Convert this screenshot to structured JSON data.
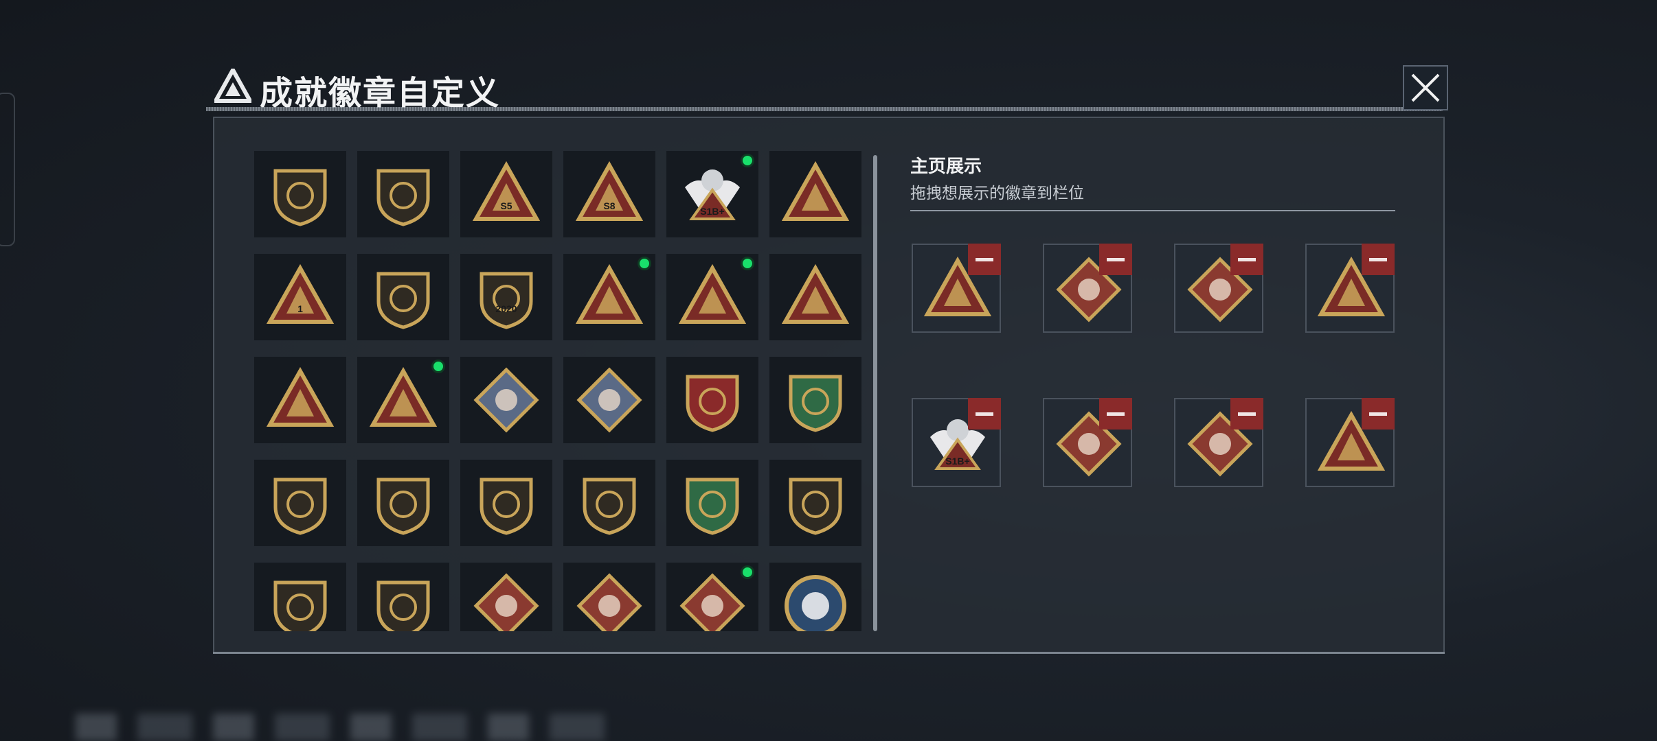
{
  "header": {
    "title": "成就徽章自定义"
  },
  "right_panel": {
    "title": "主页展示",
    "subtitle": "拖拽想展示的徽章到栏位"
  },
  "colors": {
    "accent_green": "#19e06b",
    "remove_red": "#8a2a2a",
    "gold": "#c9a55a",
    "maroon": "#7a2b26"
  },
  "badge_grid": [
    [
      {
        "icon": "tri-logo-shield-icon",
        "new": false
      },
      {
        "icon": "helicopter-shield-icon",
        "new": false
      },
      {
        "icon": "s5-bag-triangle-icon",
        "new": false,
        "label": "S5"
      },
      {
        "icon": "s8-bag-triangle-icon",
        "new": false,
        "label": "S8"
      },
      {
        "icon": "winged-skull-s1b-icon",
        "new": true,
        "label": "S1B+"
      },
      {
        "icon": "gold-egg-triangle-icon",
        "new": false
      }
    ],
    [
      {
        "icon": "number-one-triangle-icon",
        "new": false,
        "label": "1"
      },
      {
        "icon": "delta-force-tank-icon",
        "new": false
      },
      {
        "icon": "delta-force-2020-icon",
        "new": false,
        "label": "2020"
      },
      {
        "icon": "usb-drive-triangle-icon",
        "new": true
      },
      {
        "icon": "helmet-triangle-icon",
        "new": true
      },
      {
        "icon": "hands-gem-triangle-icon",
        "new": false
      }
    ],
    [
      {
        "icon": "soldiers-triangle-icon",
        "new": false
      },
      {
        "icon": "rocket-triangle-icon",
        "new": true
      },
      {
        "icon": "rose-diamond-icon",
        "new": false
      },
      {
        "icon": "boat-diamond-icon",
        "new": false
      },
      {
        "icon": "star-shield-icon",
        "new": false
      },
      {
        "icon": "green-shield-icon",
        "new": false
      }
    ],
    [
      {
        "icon": "winged-shield-icon",
        "new": false
      },
      {
        "icon": "gem-shield-icon",
        "new": false
      },
      {
        "icon": "crosshair-head-icon",
        "new": false
      },
      {
        "icon": "crosshair-skull-icon",
        "new": false
      },
      {
        "icon": "rifle-green-shield-icon",
        "new": false
      },
      {
        "icon": "rifle-bronze-shield-icon",
        "new": false
      }
    ],
    [
      {
        "icon": "rifle-shield-icon",
        "new": false
      },
      {
        "icon": "crossed-rifles-shield-icon",
        "new": false
      },
      {
        "icon": "wolf-diamond-icon",
        "new": false
      },
      {
        "icon": "wolf-diamond-icon",
        "new": false
      },
      {
        "icon": "runner-diamond-icon",
        "new": true
      },
      {
        "icon": "eagle-circle-icon",
        "new": false
      }
    ]
  ],
  "showcase_slots": [
    {
      "icon": "helmet-triangle-icon"
    },
    {
      "icon": "runner-diamond-icon"
    },
    {
      "icon": "runner-diamond-icon"
    },
    {
      "icon": "usb-drive-triangle-icon"
    },
    {
      "icon": "winged-skull-s1b-icon",
      "label": "S1B+"
    },
    {
      "icon": "tools-diamond-icon"
    },
    {
      "icon": "wheel-diamond-icon"
    },
    {
      "icon": "rocket-triangle-icon"
    }
  ]
}
